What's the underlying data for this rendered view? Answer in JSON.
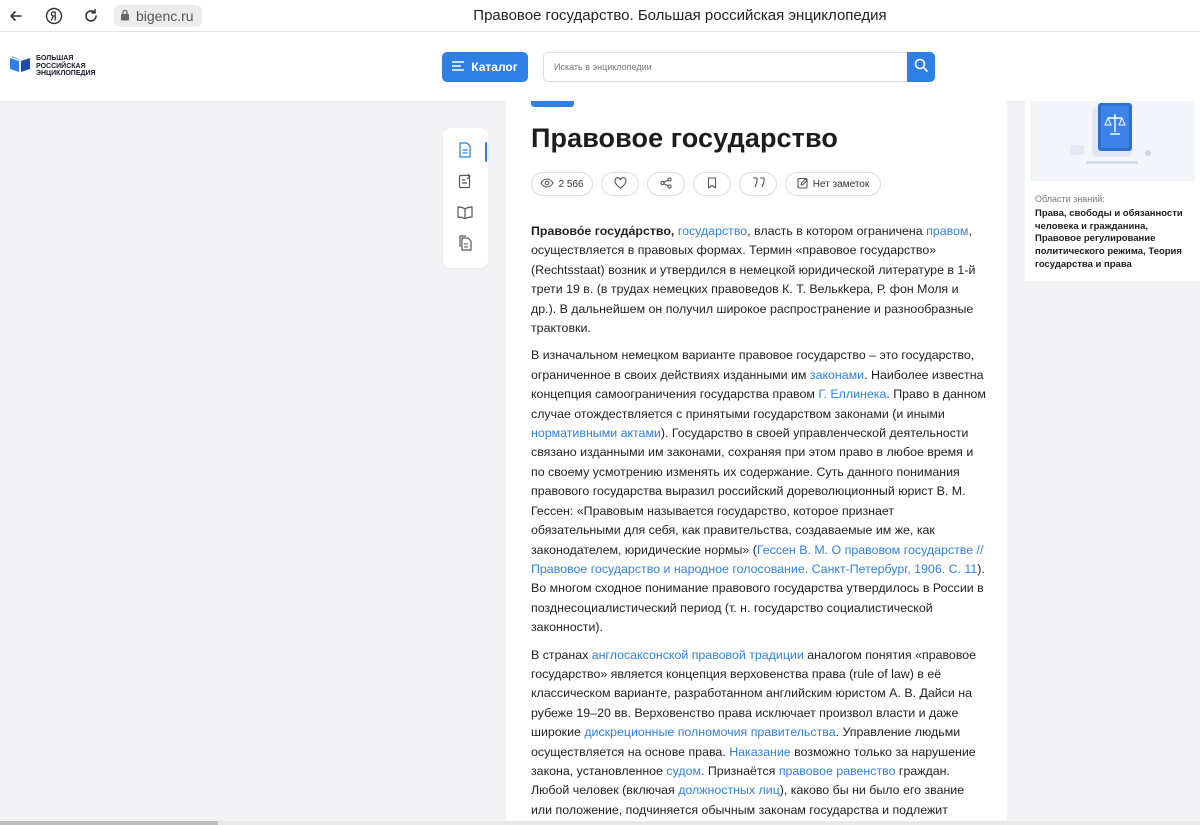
{
  "browser": {
    "url": "bigenc.ru",
    "tab_title": "Правовое государство. Большая российская энциклопедия"
  },
  "header": {
    "logo_text": "Большая российская энциклопедия",
    "catalog_label": "Каталог",
    "search_placeholder": "Искать в энциклопедии"
  },
  "article": {
    "tag": "",
    "title": "Правовое государство",
    "views": "2 566",
    "notes_label": "Нет заметок",
    "p1": {
      "term": "Правово́е госуда́рство,",
      "link1": "государство",
      "t1": ", власть в котором ограничена ",
      "link2": "правом",
      "t2": ", осуществляется в правовых формах. Термин «правовое государство» (Rechtsstaat) возник и утвердился в немецкой юридической литературе в 1-й трети 19 в. (в трудах немецких правоведов К. Т. Велькkера, Р. фон Моля и др.). В дальнейшем он получил широкое распространение и разнообразные трактовки."
    },
    "p2": {
      "t1": "В изначальном немецком варианте правовое государство – это государство, ограниченное в своих действиях изданными им ",
      "link1": "законами",
      "t2": ". Наиболее известна концепция самоограничения государства правом ",
      "link2": "Г. Еллинека",
      "t3": ". Право в данном случае отождествляется с принятыми государством законами (и иными ",
      "link3": "нормативными актами",
      "t4": "). Государство в своей управленческой деятельности связано изданными им законами, сохраняя при этом право в любое время и по своему усмотрению изменять их содержание. Суть данного понимания правового государства выразил российский дореволюционный юрист В. М. Гессен: «Правовым называется государство, которое признает обязательными для себя, как правительства, создаваемые им же, как законодателем, юридические нормы» (",
      "link4": "Гессен В. М. О правовом государстве // Правовое государство и народное голосование. Санкт-Петербург, 1906. С. 11",
      "t5": "). Во многом сходное понимание правового государства утвердилось в России в позднесоциалистический период (т. н. государство социалистической законности)."
    },
    "p3": {
      "t1": "В странах ",
      "link1": "англосаксонской правовой традиции",
      "t2": " аналогом понятия «правовое государство» является концепция верховенства права (rule of law) в её классическом варианте, разработанном английским юристом А. В. Дайси на рубеже 19–20 вв. Верховенство права исключает произвол власти и даже широкие ",
      "link2": "дискреционные полномочия",
      "t3": " ",
      "link3": "правительства",
      "t4": ". Управление людьми осуществляется на основе права. ",
      "link4": "Наказание",
      "t5": " возможно только за нарушение закона, установленное ",
      "link5": "судом",
      "t6": ". Признаётся ",
      "link6": "правовое равенство",
      "t7": " граждан. Любой человек (включая ",
      "link7": "должностных лиц",
      "t8": "), каково бы ни было его звание или положение, подчиняется обычным законам государства и подлежит"
    }
  },
  "right_panel": {
    "knowledge_label": "Области знаний:",
    "knowledge_value": "Права, свободы и обязанности человека и гражданина, Правовое регулирование политического режима, Теория государства и права"
  },
  "colors": {
    "accent": "#2f7fe6",
    "page_bg": "#f2f2f5"
  }
}
